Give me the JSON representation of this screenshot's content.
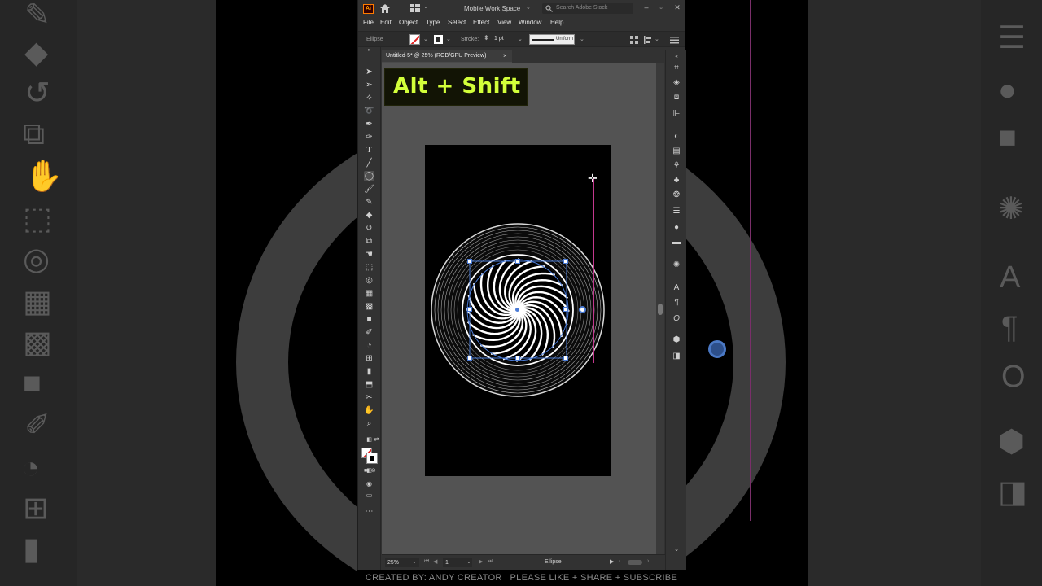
{
  "app": {
    "logo": "Ai",
    "workspace_label": "Mobile Work Space",
    "search_placeholder": "Search Adobe Stock",
    "window_controls": [
      "minimize-icon",
      "maximize-icon",
      "close-icon"
    ]
  },
  "menu": {
    "items": [
      "File",
      "Edit",
      "Object",
      "Type",
      "Select",
      "Effect",
      "View",
      "Window",
      "Help"
    ]
  },
  "control_bar": {
    "object_type": "Ellipse",
    "stroke_label": "Stroke:",
    "stroke_weight": "1 pt",
    "stroke_profile": "Uniform",
    "fill_icon": "fill-none-swatch",
    "stroke_color": "#ffffff"
  },
  "document": {
    "tab_label": "Untitled-5* @ 25% (RGB/GPU Preview)",
    "close_glyph": "×",
    "artboard_color": "#000000",
    "artwork_stroke_color": "#ffffff",
    "selection_color": "#4a7bd6",
    "guide_color": "#c2388e"
  },
  "status": {
    "zoom": "25%",
    "page": "1",
    "tool_name": "Ellipse"
  },
  "overlay": {
    "shortcut_caption": "Alt + Shift",
    "caption_color": "#d2ff3a"
  },
  "footer": {
    "credit": "CREATED BY: ANDY CREATOR  | PLEASE LIKE  + SHARE + SUBSCRIBE"
  },
  "toolbar": {
    "tools": [
      "selection-tool",
      "direct-selection-tool",
      "magic-wand-tool",
      "lasso-tool",
      "pen-tool",
      "curvature-tool",
      "type-tool",
      "line-tool",
      "ellipse-tool",
      "paintbrush-tool",
      "pencil-tool",
      "eraser-tool",
      "rotate-tool",
      "scale-tool",
      "warp-tool",
      "free-transform-tool",
      "shape-builder-tool",
      "perspective-grid-tool",
      "mesh-tool",
      "gradient-tool",
      "eyedropper-tool",
      "blend-tool",
      "symbol-sprayer-tool",
      "column-graph-tool",
      "artboard-tool",
      "slice-tool",
      "hand-tool",
      "zoom-tool"
    ]
  },
  "right_panel": {
    "icons": [
      "transform-icon",
      "layers-icon",
      "pathfinder-icon",
      "align-icon",
      "color-guide-icon",
      "swatches-icon",
      "brushes-icon",
      "symbols-icon",
      "graphic-styles-icon",
      "stroke-icon",
      "appearance-icon",
      "gradient-icon",
      "transparency-icon",
      "character-icon",
      "paragraph-icon",
      "opentype-icon",
      "image-trace-icon",
      "export-icon"
    ]
  }
}
